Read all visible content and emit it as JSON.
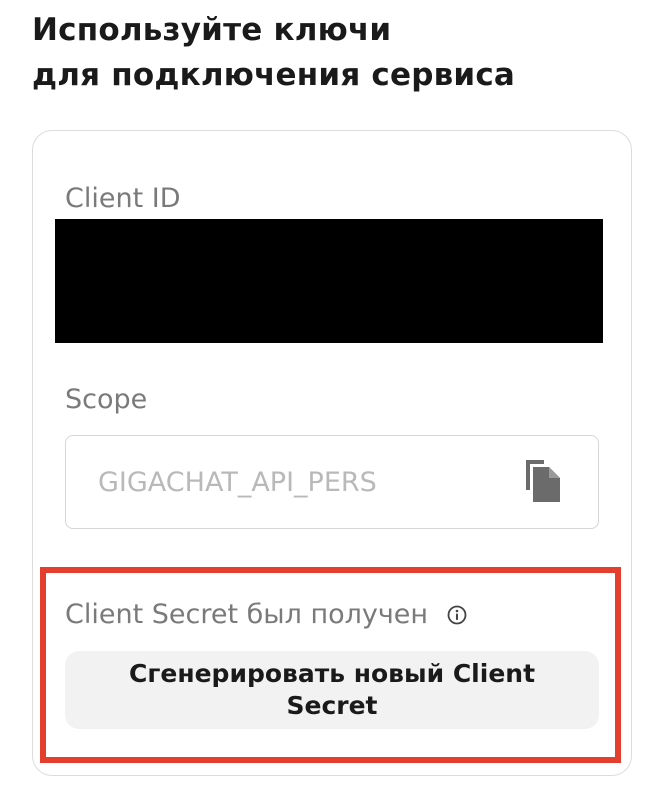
{
  "heading": {
    "line1": "Используйте ключи",
    "line2": "для подключения сервиса"
  },
  "credentials": {
    "client_id_label": "Client ID",
    "scope_label": "Scope",
    "scope_value": "GIGACHAT_API_PERS",
    "copy_icon": "copy-icon"
  },
  "secret": {
    "status_text": "Client Secret был получен",
    "info_icon": "info-icon",
    "generate_button_label": "Сгенерировать новый Client Secret"
  },
  "colors": {
    "highlight_border": "#e43f2e",
    "button_background": "#f2f2f2",
    "redaction": "#000000"
  }
}
